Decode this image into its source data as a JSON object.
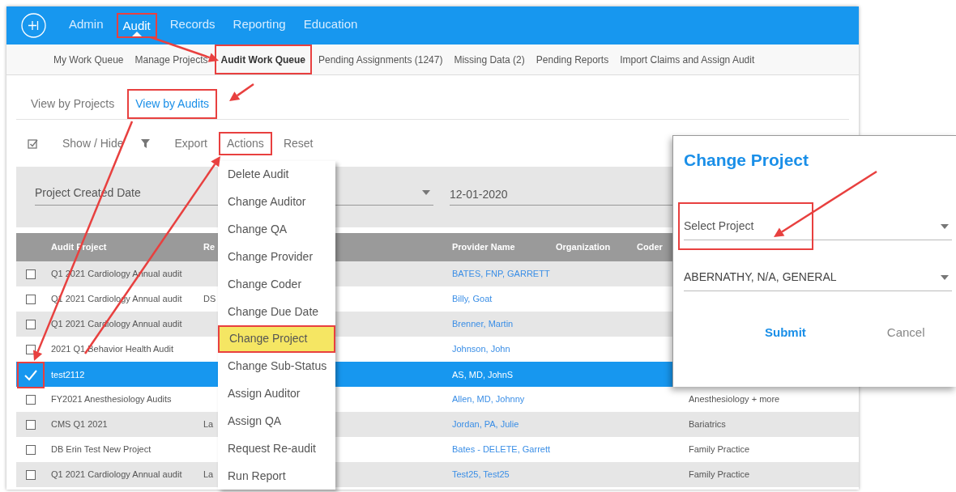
{
  "nav": [
    {
      "label": "Admin",
      "selected": false,
      "highlighted": false
    },
    {
      "label": "Audit",
      "selected": true,
      "highlighted": true
    },
    {
      "label": "Records",
      "selected": false,
      "highlighted": false
    },
    {
      "label": "Reporting",
      "selected": false,
      "highlighted": false
    },
    {
      "label": "Education",
      "selected": false,
      "highlighted": false
    }
  ],
  "subnav": [
    {
      "label": "My Work Queue",
      "selected": false,
      "highlighted": false
    },
    {
      "label": "Manage Projects",
      "selected": false,
      "highlighted": false
    },
    {
      "label": "Audit Work Queue",
      "selected": true,
      "highlighted": true
    },
    {
      "label": "Pending Assignments (1247)",
      "selected": false,
      "highlighted": false
    },
    {
      "label": "Missing Data (2)",
      "selected": false,
      "highlighted": false
    },
    {
      "label": "Pending Reports",
      "selected": false,
      "highlighted": false
    },
    {
      "label": "Import Claims and Assign Audit",
      "selected": false,
      "highlighted": false
    }
  ],
  "view_tabs": [
    {
      "label": "View by Projects",
      "selected": false,
      "highlighted": false
    },
    {
      "label": "View by Audits",
      "selected": true,
      "highlighted": true
    }
  ],
  "toolbar": [
    {
      "label": "Show / Hide",
      "highlighted": false
    },
    {
      "label": "Export",
      "highlighted": false
    },
    {
      "label": "Actions",
      "highlighted": true
    },
    {
      "label": "Reset",
      "highlighted": false
    }
  ],
  "filters": [
    {
      "kind": "select",
      "value": "Project Created Date"
    },
    {
      "kind": "date",
      "value": "12-01-2020"
    }
  ],
  "table": {
    "columns": [
      "Audit Project",
      "Re",
      "Provider Name",
      "Organization",
      "Coder"
    ],
    "rows": [
      {
        "selected": false,
        "checked": false,
        "highlighted": false,
        "audit_project": "Q1 2021 Cardiology Annual audit",
        "provider_name": "BATES, FNP, GARRETT"
      },
      {
        "selected": false,
        "checked": false,
        "highlighted": false,
        "audit_project": "Q1 2021 Cardiology Annual audit",
        "column_2": "DS",
        "provider_name": "Billy, Goat"
      },
      {
        "selected": false,
        "checked": false,
        "highlighted": false,
        "audit_project": "Q1 2021 Cardiology Annual audit",
        "provider_name": "Brenner, Martin"
      },
      {
        "selected": false,
        "checked": false,
        "highlighted": false,
        "audit_project": "2021 Q1 Behavior Health Audit",
        "provider_name": "Johnson, John"
      },
      {
        "selected": true,
        "checked": true,
        "highlighted": true,
        "audit_project": "test2112",
        "provider_name": "AS, MD, JohnS"
      },
      {
        "selected": false,
        "checked": false,
        "highlighted": false,
        "audit_project": "FY2021 Anesthesiology Audits",
        "provider_name": "Allen, MD, Johnny",
        "column_6": "Anesthesiology + more"
      },
      {
        "selected": false,
        "checked": false,
        "highlighted": false,
        "audit_project": "CMS Q1 2021",
        "column_2": "La",
        "provider_name": "Jordan, PA, Julie",
        "column_6": "Bariatrics"
      },
      {
        "selected": false,
        "checked": false,
        "highlighted": false,
        "audit_project": "DB Erin Test New Project",
        "provider_name": "Bates - DELETE, Garrett",
        "column_6": "Family Practice"
      },
      {
        "selected": false,
        "checked": false,
        "highlighted": false,
        "audit_project": "Q1 2021 Cardiology Annual audit",
        "column_2": "La",
        "provider_name": "Test25, Test25",
        "column_6": "Family Practice"
      }
    ]
  },
  "actions_menu": [
    {
      "label": "Delete Audit",
      "highlighted": false
    },
    {
      "label": "Change Auditor",
      "highlighted": false
    },
    {
      "label": "Change QA",
      "highlighted": false
    },
    {
      "label": "Change Provider",
      "highlighted": false
    },
    {
      "label": "Change Coder",
      "highlighted": false
    },
    {
      "label": "Change Due Date",
      "highlighted": false
    },
    {
      "label": "Change Project",
      "highlighted": true
    },
    {
      "label": "Change Sub-Status",
      "highlighted": false
    },
    {
      "label": "Assign Auditor",
      "highlighted": false
    },
    {
      "label": "Assign QA",
      "highlighted": false
    },
    {
      "label": "Request Re-audit",
      "highlighted": false
    },
    {
      "label": "Run Report",
      "highlighted": false
    }
  ],
  "dialog": {
    "title": "Change Project",
    "fields": [
      {
        "placeholder": "Select Project",
        "highlighted": true
      },
      {
        "value": "ABERNATHY, N/A, GENERAL",
        "highlighted": false
      }
    ],
    "buttons": [
      {
        "label": "Submit",
        "kind": "primary"
      },
      {
        "label": "Cancel",
        "kind": "secondary"
      }
    ]
  }
}
